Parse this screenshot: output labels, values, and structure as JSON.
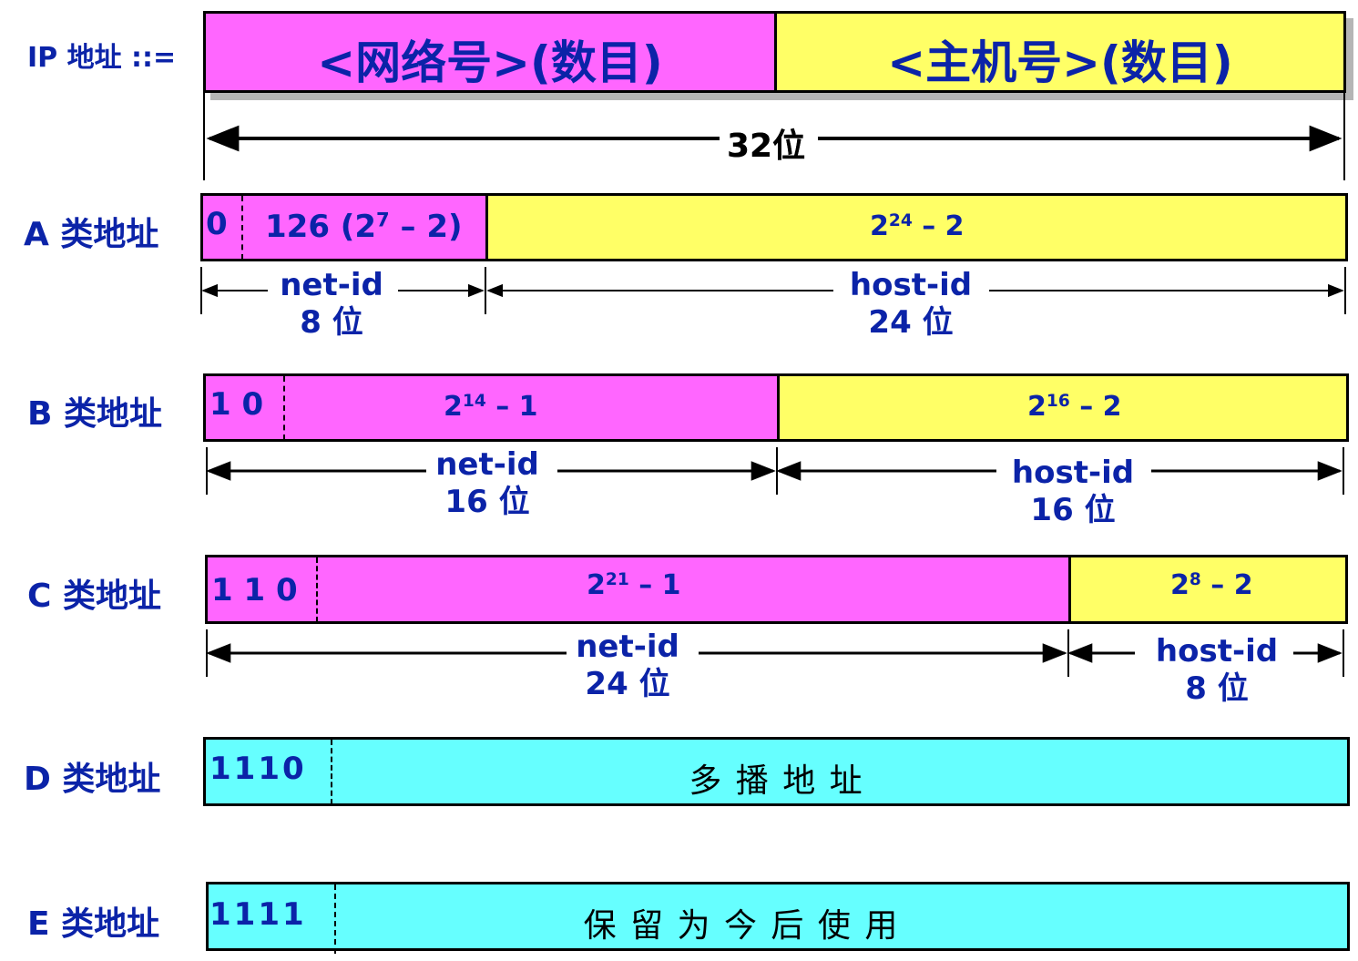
{
  "header": {
    "label": "IP 地址 ::=",
    "net_field": "<网络号>(数目)",
    "host_field": "<主机号>(数目)",
    "total_bits": "32位"
  },
  "class_a": {
    "label": "A 类地址",
    "prefix": "0",
    "net_count_base": "126 (2",
    "net_count_exp": "7",
    "net_count_tail": " – 2)",
    "host_count_base": "2",
    "host_count_exp": "24",
    "host_count_tail": " – 2",
    "net_name": "net-id",
    "net_bits": "8 位",
    "host_name": "host-id",
    "host_bits": "24 位"
  },
  "class_b": {
    "label": "B 类地址",
    "prefix": "1 0",
    "net_count_base": "2",
    "net_count_exp": "14",
    "net_count_tail": " – 1",
    "host_count_base": "2",
    "host_count_exp": "16",
    "host_count_tail": " – 2",
    "net_name": "net-id",
    "net_bits": "16 位",
    "host_name": "host-id",
    "host_bits": "16 位"
  },
  "class_c": {
    "label": "C 类地址",
    "prefix": "1 1 0",
    "net_count_base": "2",
    "net_count_exp": "21",
    "net_count_tail": " – 1",
    "host_count_base": "2",
    "host_count_exp": "8",
    "host_count_tail": " – 2",
    "net_name": "net-id",
    "net_bits": "24 位",
    "host_name": "host-id",
    "host_bits": "8 位"
  },
  "class_d": {
    "label": "D 类地址",
    "prefix": "1110",
    "body": "多 播 地 址"
  },
  "class_e": {
    "label": "E 类地址",
    "prefix": "1111",
    "body": "保 留 为 今 后 使 用"
  },
  "colors": {
    "network": "#ff66ff",
    "host": "#ffff66",
    "special": "#66ffff",
    "label_text": "#0b23a8"
  }
}
